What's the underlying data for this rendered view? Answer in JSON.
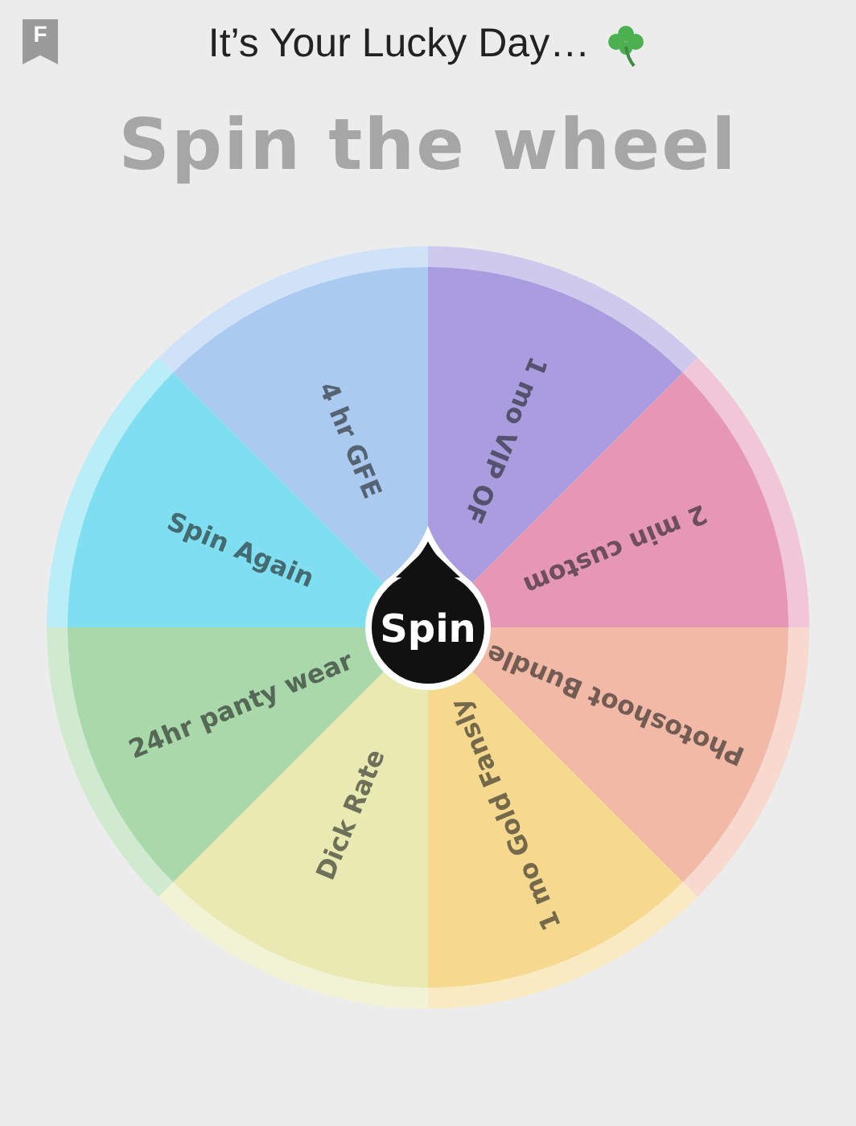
{
  "header": {
    "badge": "F",
    "title": "It’s Your Lucky Day…"
  },
  "heading": "Spin the wheel",
  "wheel": {
    "button": "Spin",
    "segments": [
      {
        "label": "1 mo VIP OF",
        "color": "#a99de0"
      },
      {
        "label": "2 min custom",
        "color": "#e597b5"
      },
      {
        "label": "Photoshoot Bundle",
        "color": "#f1b9a6"
      },
      {
        "label": "1 mo Gold Fansly",
        "color": "#f6d98f"
      },
      {
        "label": "Dick Rate",
        "color": "#e8eab2"
      },
      {
        "label": "24hr panty wear",
        "color": "#a9d8aa"
      },
      {
        "label": "Spin Again",
        "color": "#7fdff0"
      },
      {
        "label": "4 hr GFE",
        "color": "#aacaf0"
      }
    ]
  }
}
